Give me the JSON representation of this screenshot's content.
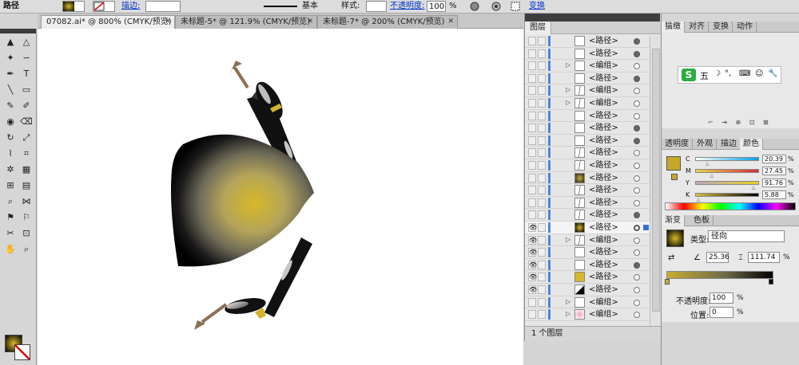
{
  "control_bar": {
    "object_type": "路径",
    "stroke_label": "描边:",
    "stroke_line_label": "基本",
    "style_label": "样式:",
    "opacity_label": "不透明度:",
    "opacity_value": "100",
    "opacity_unit": "%",
    "transform_label": "变换"
  },
  "tabs": [
    {
      "label": "07082.ai* @ 800% (CMYK/预览)",
      "close": "✕"
    },
    {
      "label": "未标题-5* @ 121.9% (CMYK/预览)",
      "close": "✕"
    },
    {
      "label": "未标题-7* @ 200% (CMYK/预览)",
      "close": "✕"
    }
  ],
  "layers_panel": {
    "title": "图层",
    "footer": "1 个图层",
    "rows": [
      {
        "name": "<路径>",
        "expand": "",
        "thumb": "blank",
        "target": "filled",
        "eye": ""
      },
      {
        "name": "<路径>",
        "expand": "",
        "thumb": "blank",
        "target": "filled",
        "eye": ""
      },
      {
        "name": "<编组>",
        "expand": "▷",
        "thumb": "blank",
        "target": "empty",
        "eye": ""
      },
      {
        "name": "<路径>",
        "expand": "",
        "thumb": "blank",
        "target": "filled",
        "eye": ""
      },
      {
        "name": "<编组>",
        "expand": "▷",
        "thumb": "stroke",
        "target": "empty",
        "eye": ""
      },
      {
        "name": "<编组>",
        "expand": "▷",
        "thumb": "stroke",
        "target": "empty",
        "eye": ""
      },
      {
        "name": "<路径>",
        "expand": "",
        "thumb": "blank",
        "target": "empty",
        "eye": ""
      },
      {
        "name": "<路径>",
        "expand": "",
        "thumb": "blank",
        "target": "filled",
        "eye": ""
      },
      {
        "name": "<路径>",
        "expand": "",
        "thumb": "curve",
        "target": "filled",
        "eye": ""
      },
      {
        "name": "<路径>",
        "expand": "",
        "thumb": "stroke",
        "target": "empty",
        "eye": ""
      },
      {
        "name": "<路径>",
        "expand": "",
        "thumb": "stroke",
        "target": "empty",
        "eye": ""
      },
      {
        "name": "<路径>",
        "expand": "",
        "thumb": "dark",
        "target": "empty",
        "eye": ""
      },
      {
        "name": "<路径>",
        "expand": "",
        "thumb": "stroke",
        "target": "empty",
        "eye": ""
      },
      {
        "name": "<路径>",
        "expand": "",
        "thumb": "stroke",
        "target": "empty",
        "eye": ""
      },
      {
        "name": "<路径>",
        "expand": "",
        "thumb": "stroke",
        "target": "filled",
        "eye": ""
      },
      {
        "name": "<路径>",
        "expand": "",
        "thumb": "gradient",
        "target": "selected",
        "eye": "👁"
      },
      {
        "name": "<编组>",
        "expand": "▷",
        "thumb": "stroke",
        "target": "empty",
        "eye": "👁"
      },
      {
        "name": "<路径>",
        "expand": "",
        "thumb": "blank",
        "target": "empty",
        "eye": "👁"
      },
      {
        "name": "<路径>",
        "expand": "",
        "thumb": "blank",
        "target": "filled",
        "eye": "👁"
      },
      {
        "name": "<路径>",
        "expand": "",
        "thumb": "gold",
        "target": "empty",
        "eye": "👁"
      },
      {
        "name": "<路径>",
        "expand": "",
        "thumb": "check",
        "target": "empty",
        "eye": "👁"
      },
      {
        "name": "<编组>",
        "expand": "▷",
        "thumb": "blank",
        "target": "empty",
        "eye": ""
      },
      {
        "name": "<编组>",
        "expand": "▷",
        "thumb": "pink",
        "target": "empty",
        "eye": ""
      }
    ]
  },
  "nav_panel": {
    "tabs": [
      "猫缴",
      "对齐",
      "变换",
      "动作"
    ],
    "ime_label": "五"
  },
  "color_panel": {
    "tabs": [
      "透明度",
      "外观",
      "描边",
      "颜色"
    ],
    "channels": [
      {
        "label": "C",
        "value": "20.39",
        "pos": 0.2
      },
      {
        "label": "M",
        "value": "27.45",
        "pos": 0.27
      },
      {
        "label": "Y",
        "value": "91.76",
        "pos": 0.92
      },
      {
        "label": "K",
        "value": "5.88",
        "pos": 0.06
      }
    ],
    "pct": "%"
  },
  "gradient_panel": {
    "tabs": [
      "渐变",
      "色板"
    ],
    "type_label": "类型:",
    "type_value": "径向",
    "angle_value": "25.36",
    "aspect_value": "111.74",
    "pct": "%",
    "opacity_label": "不透明度:",
    "opacity_value": "100",
    "location_label": "位置:",
    "location_value": "0"
  }
}
